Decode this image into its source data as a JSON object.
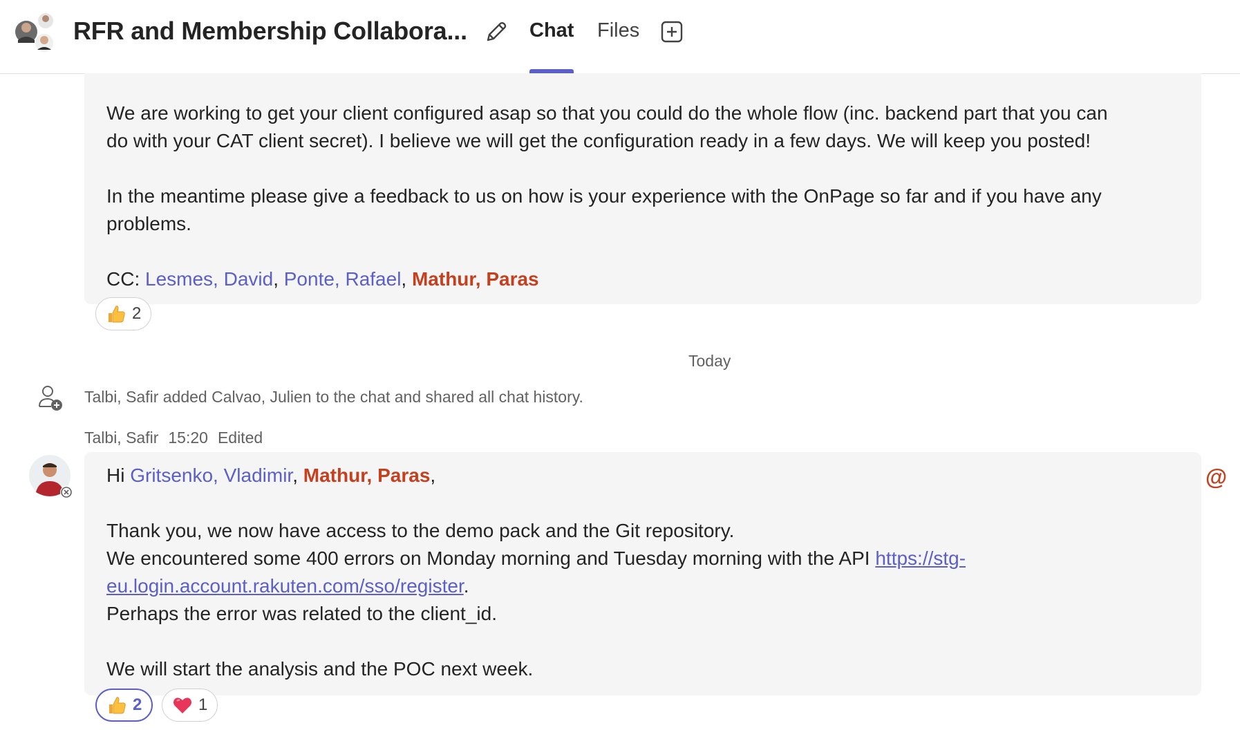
{
  "header": {
    "title": "RFR and Membership Collabora...",
    "tabs": [
      {
        "label": "Chat",
        "active": true
      },
      {
        "label": "Files",
        "active": false
      }
    ],
    "accent_color": "#5b5fc7"
  },
  "messages": [
    {
      "paragraphs": {
        "p1": "We are working to get your client configured asap so that you could do the whole flow (inc. backend part that you can",
        "p1b": "do with your CAT client secret). I believe we will get the configuration ready in a few days. We will keep you posted!",
        "p2": "In the meantime please give a feedback to us on how is your experience with the OnPage so far and if you have any",
        "p2b": "problems.",
        "cc_prefix": "CC: ",
        "cc": [
          "Lesmes, David",
          "Ponte, Rafael",
          "Mathur, Paras"
        ],
        "separator": ", "
      },
      "reactions": [
        {
          "emoji": "thumbs-up-icon",
          "count": "2",
          "self": false
        }
      ]
    },
    {
      "author": "Talbi, Safir",
      "time": "15:20",
      "edited": "Edited",
      "greeting": "Hi ",
      "mentions": [
        "Gritsenko, Vladimir",
        "Mathur, Paras"
      ],
      "greeting_sep": ", ",
      "greeting_end": ",",
      "lines": {
        "l1": "Thank you, we now have access to the demo pack and the Git repository.",
        "l2": "We encountered some 400 errors on Monday morning and Tuesday morning with the API ",
        "link_part1": "https://stg-",
        "link_part2": "eu.login.account.rakuten.com/sso/register",
        "l2_end": ".",
        "l3": "Perhaps the error was related to the client_id.",
        "l4": "We will start the analysis and the POC next week."
      },
      "reactions": [
        {
          "emoji": "thumbs-up-icon",
          "count": "2",
          "self": true
        },
        {
          "emoji": "heart-icon",
          "count": "1",
          "self": false
        }
      ]
    }
  ],
  "date_divider": "Today",
  "system_message": "Talbi, Safir added Calvao, Julien to the chat and shared all chat history.",
  "at_icon": "@"
}
